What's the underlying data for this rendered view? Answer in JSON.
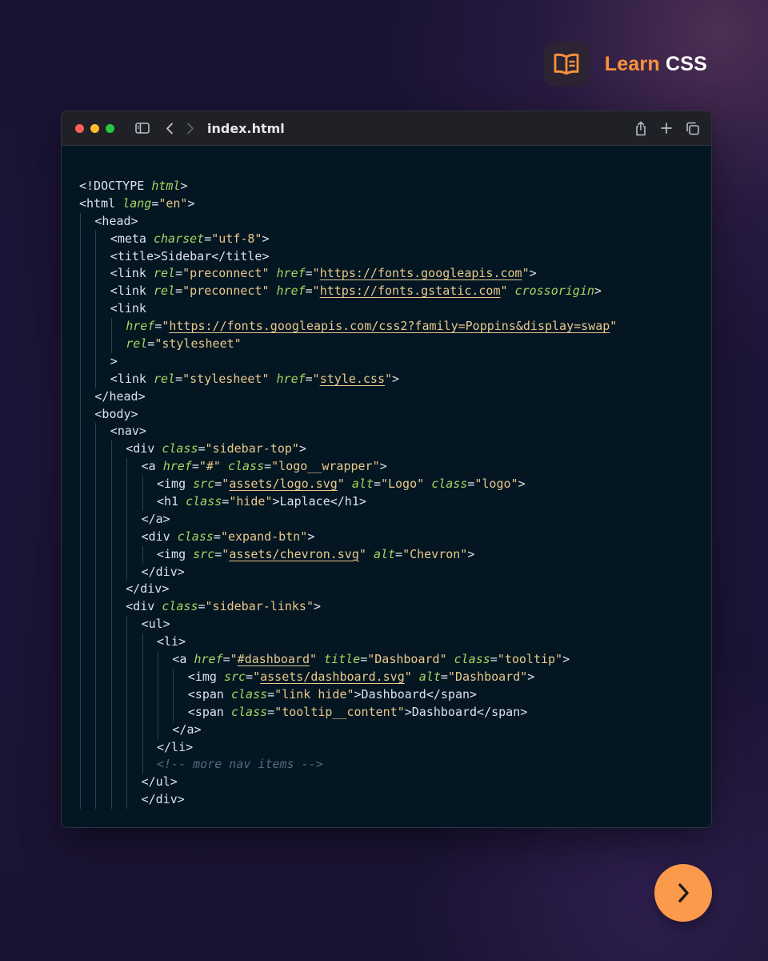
{
  "brand": {
    "accent_word": "Learn",
    "strong_word": "CSS",
    "icon": "book-icon",
    "colors": {
      "accent": "#fb923c",
      "badge_bg": "#2c2333"
    }
  },
  "window": {
    "title": "index.html",
    "icons": [
      "sidebar-toggle-icon",
      "back-chevron-icon",
      "forward-chevron-icon",
      "share-icon",
      "plus-icon",
      "copy-tabs-icon"
    ],
    "colors": {
      "close": "#ff5f57",
      "minimize": "#febc2e",
      "zoom": "#28c840"
    }
  },
  "code_lines": [
    {
      "indent": 0,
      "tokens": [
        [
          "tag",
          "<!DOCTYPE "
        ],
        [
          "kw",
          "html"
        ],
        [
          "tag",
          ">"
        ]
      ]
    },
    {
      "indent": 0,
      "tokens": [
        [
          "tag",
          "<html "
        ],
        [
          "attr",
          "lang"
        ],
        [
          "eq",
          "="
        ],
        [
          "str",
          "\"en\""
        ],
        [
          "tag",
          ">"
        ]
      ]
    },
    {
      "indent": 1,
      "tokens": [
        [
          "tag",
          "<head>"
        ]
      ]
    },
    {
      "indent": 2,
      "tokens": [
        [
          "tag",
          "<meta "
        ],
        [
          "attr",
          "charset"
        ],
        [
          "eq",
          "="
        ],
        [
          "str",
          "\"utf-8\""
        ],
        [
          "tag",
          ">"
        ]
      ]
    },
    {
      "indent": 2,
      "tokens": [
        [
          "tag",
          "<title>"
        ],
        [
          "text",
          "Sidebar"
        ],
        [
          "tag",
          "</title>"
        ]
      ]
    },
    {
      "indent": 2,
      "tokens": [
        [
          "tag",
          "<link "
        ],
        [
          "attr",
          "rel"
        ],
        [
          "eq",
          "="
        ],
        [
          "str",
          "\"preconnect\" "
        ],
        [
          "attr",
          "href"
        ],
        [
          "eq",
          "="
        ],
        [
          "str",
          "\""
        ],
        [
          "url",
          "https://fonts.googleapis.com"
        ],
        [
          "str",
          "\""
        ],
        [
          "tag",
          ">"
        ]
      ]
    },
    {
      "indent": 2,
      "tokens": [
        [
          "tag",
          "<link "
        ],
        [
          "attr",
          "rel"
        ],
        [
          "eq",
          "="
        ],
        [
          "str",
          "\"preconnect\" "
        ],
        [
          "attr",
          "href"
        ],
        [
          "eq",
          "="
        ],
        [
          "str",
          "\""
        ],
        [
          "url",
          "https://fonts.gstatic.com"
        ],
        [
          "str",
          "\" "
        ],
        [
          "attr",
          "crossorigin"
        ],
        [
          "tag",
          ">"
        ]
      ]
    },
    {
      "indent": 2,
      "tokens": [
        [
          "tag",
          "<link"
        ]
      ]
    },
    {
      "indent": 3,
      "tokens": [
        [
          "attr",
          "href"
        ],
        [
          "eq",
          "="
        ],
        [
          "str",
          "\""
        ],
        [
          "url",
          "https://fonts.googleapis.com/css2?family=Poppins&display=swap"
        ],
        [
          "str",
          "\""
        ]
      ]
    },
    {
      "indent": 3,
      "tokens": [
        [
          "attr",
          "rel"
        ],
        [
          "eq",
          "="
        ],
        [
          "str",
          "\"stylesheet\""
        ]
      ]
    },
    {
      "indent": 2,
      "tokens": [
        [
          "tag",
          ">"
        ]
      ]
    },
    {
      "indent": 2,
      "tokens": [
        [
          "tag",
          "<link "
        ],
        [
          "attr",
          "rel"
        ],
        [
          "eq",
          "="
        ],
        [
          "str",
          "\"stylesheet\" "
        ],
        [
          "attr",
          "href"
        ],
        [
          "eq",
          "="
        ],
        [
          "str",
          "\""
        ],
        [
          "url",
          "style.css"
        ],
        [
          "str",
          "\""
        ],
        [
          "tag",
          ">"
        ]
      ]
    },
    {
      "indent": 1,
      "tokens": [
        [
          "tag",
          "</head>"
        ]
      ]
    },
    {
      "indent": 1,
      "tokens": [
        [
          "tag",
          "<body>"
        ]
      ]
    },
    {
      "indent": 2,
      "tokens": [
        [
          "tag",
          "<nav>"
        ]
      ]
    },
    {
      "indent": 3,
      "tokens": [
        [
          "tag",
          "<div "
        ],
        [
          "attr",
          "class"
        ],
        [
          "eq",
          "="
        ],
        [
          "str",
          "\"sidebar-top\""
        ],
        [
          "tag",
          ">"
        ]
      ]
    },
    {
      "indent": 4,
      "tokens": [
        [
          "tag",
          "<a "
        ],
        [
          "attr",
          "href"
        ],
        [
          "eq",
          "="
        ],
        [
          "str",
          "\"#\" "
        ],
        [
          "attr",
          "class"
        ],
        [
          "eq",
          "="
        ],
        [
          "str",
          "\"logo__wrapper\""
        ],
        [
          "tag",
          ">"
        ]
      ]
    },
    {
      "indent": 5,
      "tokens": [
        [
          "tag",
          "<img "
        ],
        [
          "attr",
          "src"
        ],
        [
          "eq",
          "="
        ],
        [
          "str",
          "\""
        ],
        [
          "url",
          "assets/logo.svg"
        ],
        [
          "str",
          "\" "
        ],
        [
          "attr",
          "alt"
        ],
        [
          "eq",
          "="
        ],
        [
          "str",
          "\"Logo\" "
        ],
        [
          "attr",
          "class"
        ],
        [
          "eq",
          "="
        ],
        [
          "str",
          "\"logo\""
        ],
        [
          "tag",
          ">"
        ]
      ]
    },
    {
      "indent": 5,
      "tokens": [
        [
          "tag",
          "<h1 "
        ],
        [
          "attr",
          "class"
        ],
        [
          "eq",
          "="
        ],
        [
          "str",
          "\"hide\""
        ],
        [
          "tag",
          ">"
        ],
        [
          "text",
          "Laplace"
        ],
        [
          "tag",
          "</h1>"
        ]
      ]
    },
    {
      "indent": 4,
      "tokens": [
        [
          "tag",
          "</a>"
        ]
      ]
    },
    {
      "indent": 4,
      "tokens": [
        [
          "tag",
          "<div "
        ],
        [
          "attr",
          "class"
        ],
        [
          "eq",
          "="
        ],
        [
          "str",
          "\"expand-btn\""
        ],
        [
          "tag",
          ">"
        ]
      ]
    },
    {
      "indent": 5,
      "tokens": [
        [
          "tag",
          "<img "
        ],
        [
          "attr",
          "src"
        ],
        [
          "eq",
          "="
        ],
        [
          "str",
          "\""
        ],
        [
          "url",
          "assets/chevron.svg"
        ],
        [
          "str",
          "\" "
        ],
        [
          "attr",
          "alt"
        ],
        [
          "eq",
          "="
        ],
        [
          "str",
          "\"Chevron\""
        ],
        [
          "tag",
          ">"
        ]
      ]
    },
    {
      "indent": 4,
      "tokens": [
        [
          "tag",
          "</div>"
        ]
      ]
    },
    {
      "indent": 3,
      "tokens": [
        [
          "tag",
          "</div>"
        ]
      ]
    },
    {
      "indent": 3,
      "tokens": [
        [
          "tag",
          "<div "
        ],
        [
          "attr",
          "class"
        ],
        [
          "eq",
          "="
        ],
        [
          "str",
          "\"sidebar-links\""
        ],
        [
          "tag",
          ">"
        ]
      ]
    },
    {
      "indent": 4,
      "tokens": [
        [
          "tag",
          "<ul>"
        ]
      ]
    },
    {
      "indent": 5,
      "tokens": [
        [
          "tag",
          "<li>"
        ]
      ]
    },
    {
      "indent": 6,
      "tokens": [
        [
          "tag",
          "<a "
        ],
        [
          "attr",
          "href"
        ],
        [
          "eq",
          "="
        ],
        [
          "str",
          "\""
        ],
        [
          "url",
          "#dashboard"
        ],
        [
          "str",
          "\" "
        ],
        [
          "attr",
          "title"
        ],
        [
          "eq",
          "="
        ],
        [
          "str",
          "\"Dashboard\" "
        ],
        [
          "attr",
          "class"
        ],
        [
          "eq",
          "="
        ],
        [
          "str",
          "\"tooltip\""
        ],
        [
          "tag",
          ">"
        ]
      ]
    },
    {
      "indent": 7,
      "tokens": [
        [
          "tag",
          "<img "
        ],
        [
          "attr",
          "src"
        ],
        [
          "eq",
          "="
        ],
        [
          "str",
          "\""
        ],
        [
          "url",
          "assets/dashboard.svg"
        ],
        [
          "str",
          "\" "
        ],
        [
          "attr",
          "alt"
        ],
        [
          "eq",
          "="
        ],
        [
          "str",
          "\"Dashboard\""
        ],
        [
          "tag",
          ">"
        ]
      ]
    },
    {
      "indent": 7,
      "tokens": [
        [
          "tag",
          "<span "
        ],
        [
          "attr",
          "class"
        ],
        [
          "eq",
          "="
        ],
        [
          "str",
          "\"link hide\""
        ],
        [
          "tag",
          ">"
        ],
        [
          "text",
          "Dashboard"
        ],
        [
          "tag",
          "</span>"
        ]
      ]
    },
    {
      "indent": 7,
      "tokens": [
        [
          "tag",
          "<span "
        ],
        [
          "attr",
          "class"
        ],
        [
          "eq",
          "="
        ],
        [
          "str",
          "\"tooltip__content\""
        ],
        [
          "tag",
          ">"
        ],
        [
          "text",
          "Dashboard"
        ],
        [
          "tag",
          "</span>"
        ]
      ]
    },
    {
      "indent": 6,
      "tokens": [
        [
          "tag",
          "</a>"
        ]
      ]
    },
    {
      "indent": 5,
      "tokens": [
        [
          "tag",
          "</li>"
        ]
      ]
    },
    {
      "indent": 5,
      "tokens": [
        [
          "cmt",
          "<!-- more nav items -->"
        ]
      ]
    },
    {
      "indent": 4,
      "tokens": [
        [
          "tag",
          "</ul>"
        ]
      ]
    },
    {
      "indent": 4,
      "tokens": [
        [
          "tag",
          "</div>"
        ]
      ]
    }
  ],
  "next_button": {
    "icon": "chevron-right-icon",
    "color": "#fb9a4b"
  }
}
